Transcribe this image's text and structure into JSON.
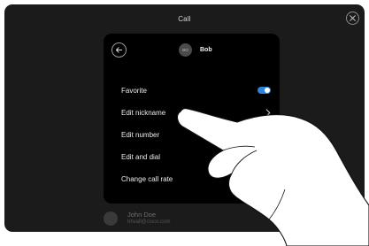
{
  "header": {
    "title": "Call",
    "close_icon": "close-icon"
  },
  "contact": {
    "initials": "BO",
    "name": "Bob",
    "back_icon": "arrow-left-icon"
  },
  "menu": [
    {
      "label": "Favorite",
      "control": "toggle",
      "state": "on"
    },
    {
      "label": "Edit nickname",
      "control": "chevron"
    },
    {
      "label": "Edit number",
      "control": "chevron"
    },
    {
      "label": "Edit and dial",
      "control": "none"
    },
    {
      "label": "Change call rate",
      "control": "none"
    }
  ],
  "background_contact": {
    "name": "John Doe",
    "email": "hhvall@cisco.com"
  },
  "colors": {
    "accent": "#2f83d8",
    "panel": "#000000",
    "screen": "#1b1b1b"
  }
}
